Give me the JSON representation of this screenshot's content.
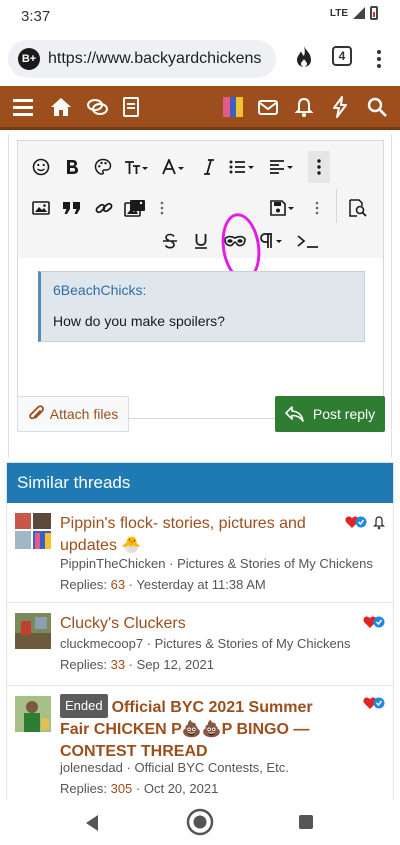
{
  "status_bar": {
    "time": "3:37",
    "network": "LTE"
  },
  "browser": {
    "site_badge": "B+",
    "url": "https://www.backyardchickens",
    "tab_count": "4"
  },
  "editor": {
    "quote": {
      "author": "6BeachChicks:",
      "text": "How do you make spoilers?"
    },
    "attach_label": "Attach files",
    "post_label": "Post reply"
  },
  "similar": {
    "heading": "Similar threads",
    "threads": [
      {
        "title": "Pippin's flock- stories, pictures and updates",
        "author": "PippinTheChicken",
        "forum": "Pictures & Stories of My Chickens",
        "replies_label": "Replies:",
        "replies": "63",
        "date": "Yesterday at 11:38 AM"
      },
      {
        "title": "Clucky's Cluckers",
        "author": "cluckmecoop7",
        "forum": "Pictures & Stories of My Chickens",
        "replies_label": "Replies:",
        "replies": "33",
        "date": "Sep 12, 2021"
      },
      {
        "badge": "Ended",
        "title": "Official BYC 2021 Summer Fair CHICKEN P💩💩P BINGO — CONTEST THREAD",
        "author": "jolenesdad",
        "forum": "Official BYC Contests, Etc.",
        "replies_label": "Replies:",
        "replies": "305",
        "date": "Oct 20, 2021"
      }
    ]
  },
  "colors": {
    "nav_brown": "#9c4f1c",
    "header_blue": "#1f7ab4",
    "post_green": "#2e7d32",
    "annotation_magenta": "#e01ee6"
  }
}
